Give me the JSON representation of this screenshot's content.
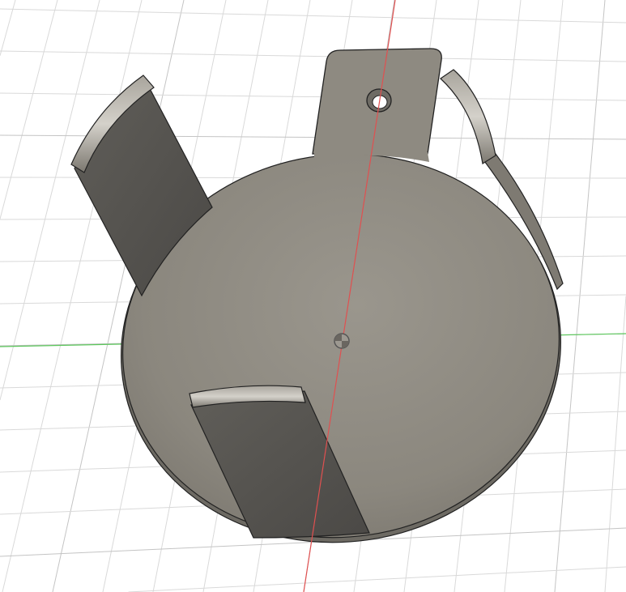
{
  "viewport": {
    "description_label": "",
    "colors": {
      "background": "#ffffff",
      "grid": "#d9d9d9",
      "x_axis": "#e04a4a",
      "y_axis": "#4ec24e",
      "body_face": "#8d8980",
      "body_dark": "#56544f",
      "edge": "#222222"
    },
    "icons": [
      "origin-point-icon"
    ]
  }
}
